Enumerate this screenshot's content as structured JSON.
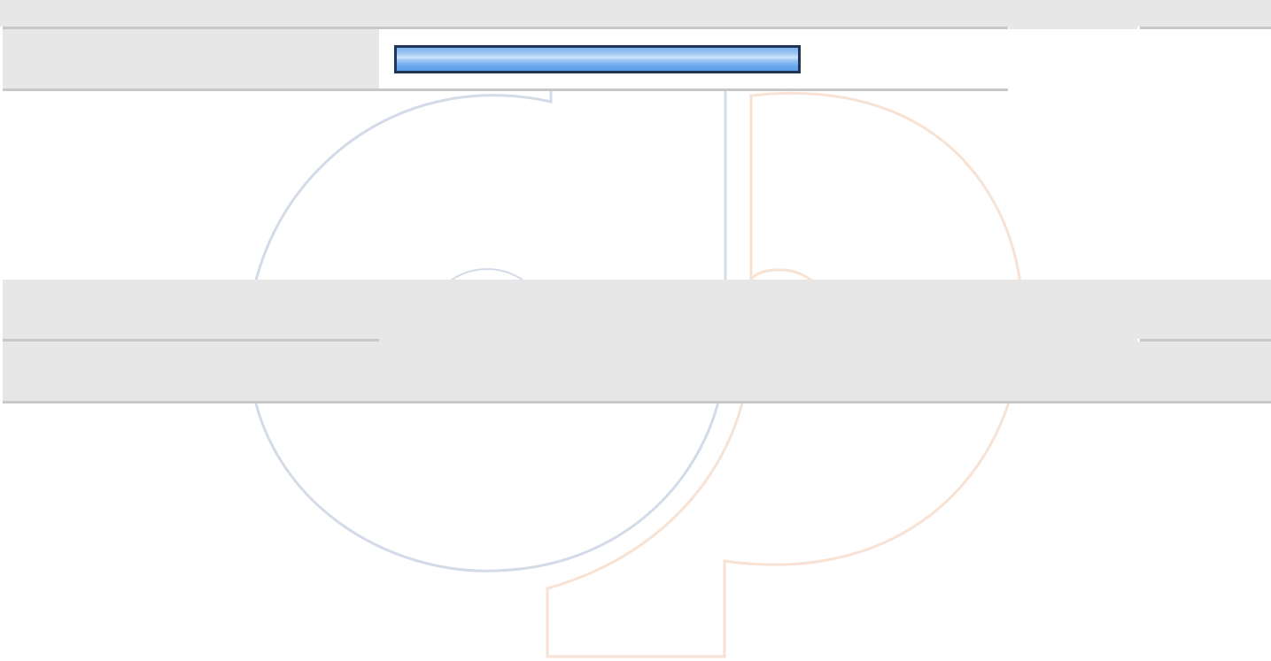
{
  "progress": {
    "value": 1.0,
    "label": ""
  },
  "colors": {
    "band_background": "#e7e7e7",
    "band_separator": "#c8c8c8",
    "progress_border": "#1e3555",
    "progress_fill": "#6aa8ef",
    "watermark_blue": "#d3dbe8",
    "watermark_orange": "#f7e2d3"
  },
  "watermark": {
    "icon": "cp-logo-watermark"
  }
}
